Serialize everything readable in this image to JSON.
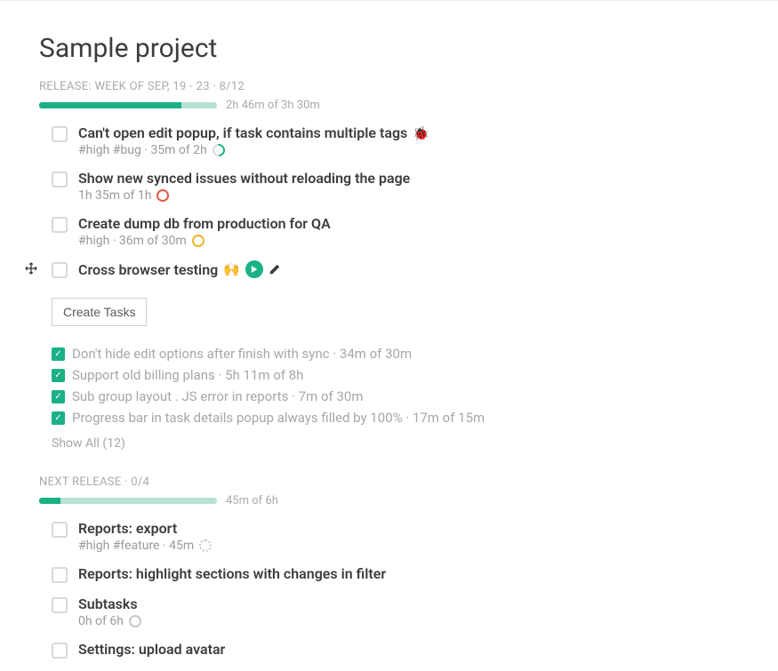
{
  "project_title": "Sample project",
  "sections": [
    {
      "header_cap": "RELEASE: WEEK OF SEP, 19 - 23",
      "header_count": "8/12",
      "progress_text": "2h 46m of 3h 30m",
      "progress_class": "pct80"
    },
    {
      "header_cap": "NEXT RELEASE",
      "header_count": "0/4",
      "progress_text": "45m of 6h",
      "progress_class": "pct12"
    }
  ],
  "tasks1": [
    {
      "title": "Can't open edit popup, if task contains multiple tags",
      "emoji": "🐞",
      "meta": "#high #bug · 35m of 2h",
      "ring": "green"
    },
    {
      "title": "Show new synced issues without reloading the page",
      "emoji": "",
      "meta": "1h 35m of 1h",
      "ring": "red"
    },
    {
      "title": "Create dump db from production for QA",
      "emoji": "",
      "meta": "#high · 36m of 30m",
      "ring": "yellow"
    }
  ],
  "task_active": {
    "title": "Cross browser testing",
    "emoji": "🙌"
  },
  "create_button": "Create Tasks",
  "done_items": [
    "Don't hide edit options after finish with sync · 34m of 30m",
    "Support old billing plans · 5h 11m of 8h",
    "Sub group layout . JS error in reports · 7m of 30m",
    "Progress bar in task details popup always filled by 100% · 17m of 15m"
  ],
  "show_all": "Show All (12)",
  "tasks2": [
    {
      "title": "Reports: export",
      "meta": "#high #feature · 45m",
      "ring": "dotted"
    },
    {
      "title": "Reports: highlight sections with changes in filter",
      "meta": "",
      "ring": ""
    },
    {
      "title": "Subtasks",
      "meta": "0h of 6h",
      "ring": "gray"
    },
    {
      "title": "Settings: upload avatar",
      "meta": "",
      "ring": ""
    }
  ]
}
